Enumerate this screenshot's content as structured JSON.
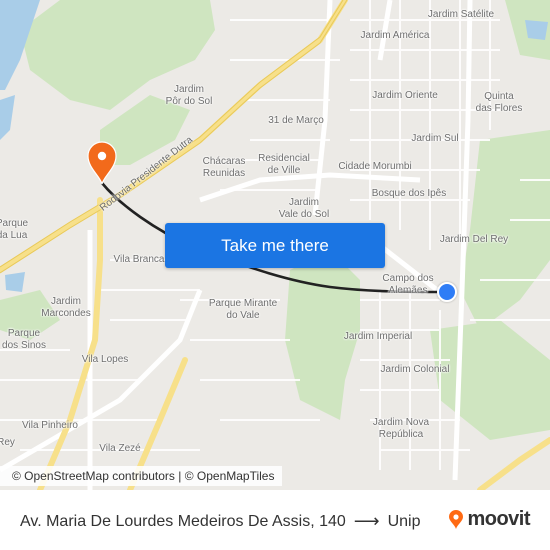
{
  "map": {
    "labels": [
      {
        "key": "jardim-satelite",
        "text": "Jardim Satélite"
      },
      {
        "key": "jardim-america",
        "text": "Jardim América"
      },
      {
        "key": "jardim-por-do-sol",
        "text": "Jardim\nPôr do Sol"
      },
      {
        "key": "jardim-oriente",
        "text": "Jardim Oriente"
      },
      {
        "key": "quinta-das-flores",
        "text": "Quinta\ndas Flores"
      },
      {
        "key": "31-de-marco",
        "text": "31 de Março"
      },
      {
        "key": "jardim-sul",
        "text": "Jardim Sul"
      },
      {
        "key": "chacaras-reunidas",
        "text": "Chácaras\nReunidas"
      },
      {
        "key": "residencial-de-ville",
        "text": "Residencial\nde Ville"
      },
      {
        "key": "cidade-morumbi",
        "text": "Cidade Morumbi"
      },
      {
        "key": "bosque-dos-ipes",
        "text": "Bosque dos Ipês"
      },
      {
        "key": "jardim-vale-do-sol",
        "text": "Jardim\nVale do Sol"
      },
      {
        "key": "parque-da-lua",
        "text": "Parque\nda Lua"
      },
      {
        "key": "jardim-del-rey",
        "text": "Jardim Del Rey"
      },
      {
        "key": "vila-branca",
        "text": "Vila Branca"
      },
      {
        "key": "campo-dos-alemaes",
        "text": "Campo dos\nAlemães"
      },
      {
        "key": "jardim-marcondes",
        "text": "Jardim\nMarcondes"
      },
      {
        "key": "parque-mirante-do-vale",
        "text": "Parque Mirante\ndo Vale"
      },
      {
        "key": "parque-dos-sinos",
        "text": "Parque\ndos Sinos"
      },
      {
        "key": "jardim-imperial",
        "text": "Jardim Imperial"
      },
      {
        "key": "vila-lopes",
        "text": "Vila Lopes"
      },
      {
        "key": "jardim-colonial",
        "text": "Jardim Colonial"
      },
      {
        "key": "vila-pinheiro",
        "text": "Vila Pinheiro"
      },
      {
        "key": "jardim-nova-republica",
        "text": "Jardim Nova\nRepública"
      },
      {
        "key": "vila-zeze",
        "text": "Vila Zezé"
      },
      {
        "key": "rey",
        "text": "Rey"
      }
    ],
    "highway_label": "Rodovia Presidente Dutra",
    "cta_label": "Take me there",
    "attribution": "© OpenStreetMap contributors | © OpenMapTiles",
    "origin_marker": "origin-pin",
    "destination_marker": "destination-dot",
    "colors": {
      "route": "#222222",
      "origin_pin": "#f26a1b",
      "destination_dot": "#2f7df6",
      "cta": "#1b75e3",
      "park": "#cfe5c0",
      "water": "#a9cde8",
      "highway": "#f7e08a"
    }
  },
  "footer": {
    "origin": "Av. Maria De Lourdes Medeiros De Assis, 140",
    "destination": "Unip",
    "arrow": "⟶",
    "brand": "moovit"
  }
}
